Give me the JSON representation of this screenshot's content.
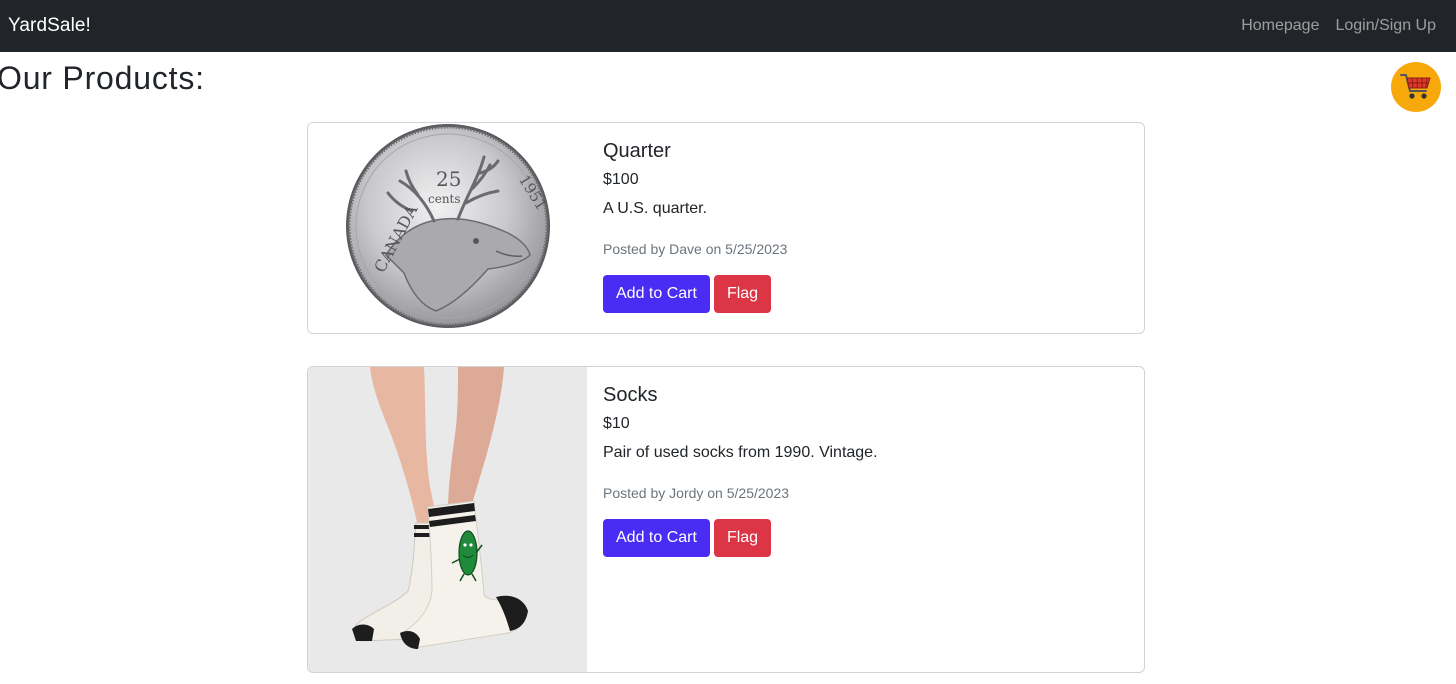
{
  "navbar": {
    "brand": "YardSale!",
    "links": [
      "Homepage",
      "Login/Sign Up"
    ]
  },
  "page": {
    "title": "Our Products:"
  },
  "cart": {
    "icon": "shopping-cart-icon"
  },
  "products": [
    {
      "name": "Quarter",
      "price": "$100",
      "description": "A U.S. quarter.",
      "posted": "Posted by Dave on 5/25/2023",
      "image": "coin-photo",
      "add_label": "Add to Cart",
      "flag_label": "Flag"
    },
    {
      "name": "Socks",
      "price": "$10",
      "description": "Pair of used socks from 1990. Vintage.",
      "posted": "Posted by Jordy on 5/25/2023",
      "image": "socks-photo",
      "add_label": "Add to Cart",
      "flag_label": "Flag"
    }
  ],
  "colors": {
    "navbar_bg": "#212529",
    "primary": "#4a2cf5",
    "danger": "#dc3545",
    "cart": "#f7a90c"
  }
}
